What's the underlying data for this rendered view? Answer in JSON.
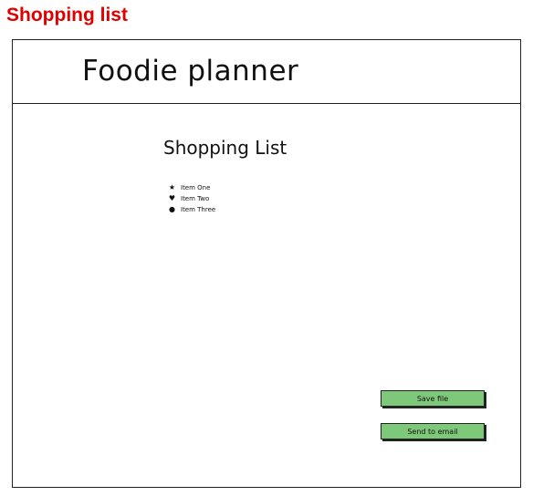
{
  "page_label": "Shopping list",
  "header": {
    "title": "Foodie planner"
  },
  "main": {
    "title": "Shopping List",
    "items": [
      {
        "label": "Item One",
        "icon": "star-icon",
        "glyph": "★"
      },
      {
        "label": "Item Two",
        "icon": "heart-icon",
        "glyph": "♥"
      },
      {
        "label": "Item Three",
        "icon": "circle-icon",
        "glyph": "●"
      }
    ]
  },
  "actions": {
    "save_label": "Save file",
    "email_label": "Send to email",
    "button_color": "#7ec87a"
  },
  "colors": {
    "page_label": "#e00000"
  }
}
